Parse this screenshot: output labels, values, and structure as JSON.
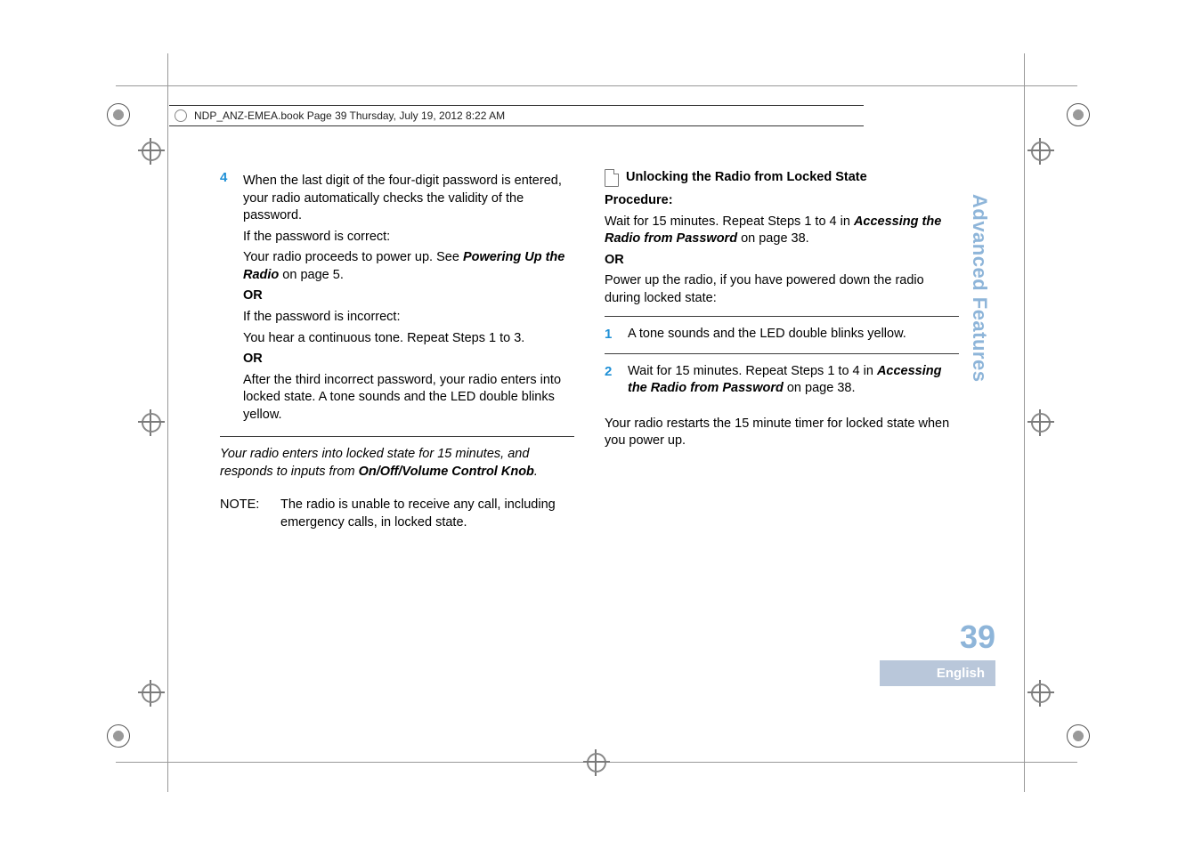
{
  "running_head": "NDP_ANZ-EMEA.book  Page 39  Thursday, July 19, 2012  8:22 AM",
  "side_tab": "Advanced Features",
  "footer": {
    "page_number": "39",
    "language": "English"
  },
  "left_column": {
    "step_number": "4",
    "step_body_1": "When the last digit of the four-digit password is entered, your radio automatically checks the validity of the password.",
    "if_correct_label": "If the password is correct:",
    "correct_line_a": "Your radio proceeds to power up. See ",
    "powering_ref": "Powering Up the Radio",
    "correct_line_b": " on page 5.",
    "or1": "OR",
    "if_incorrect_label": "If the password is incorrect:",
    "incorrect_line": "You hear a continuous tone. Repeat Steps 1 to 3.",
    "or2": "OR",
    "after_third": "After the third incorrect password, your radio enters into locked state. A tone sounds and the LED double blinks yellow.",
    "ital_a": "Your radio enters into locked state for 15 minutes, and responds to inputs from ",
    "ital_b_bold": "On/Off/Volume Control Knob",
    "ital_c": ".",
    "note_label": "NOTE:",
    "note_body": "The radio is unable to receive any call, including emergency calls, in locked state."
  },
  "right_column": {
    "heading": "Unlocking the Radio from Locked State",
    "procedure_label": "Procedure:",
    "line1a": "Wait for 15 minutes. Repeat Steps 1 to 4 in ",
    "accessing_ref": "Accessing the Radio from Password",
    "line1b": " on page 38.",
    "or": "OR",
    "line2": "Power up the radio, if you have powered down the radio during locked state:",
    "step1_num": "1",
    "step1_body": "A tone sounds and the LED double blinks yellow.",
    "step2_num": "2",
    "step2_a": "Wait for 15 minutes. Repeat Steps 1 to 4 in ",
    "step2_ref": "Accessing the Radio from Password",
    "step2_b": " on page 38.",
    "closing": "Your radio restarts the 15 minute timer for locked state when you power up."
  }
}
